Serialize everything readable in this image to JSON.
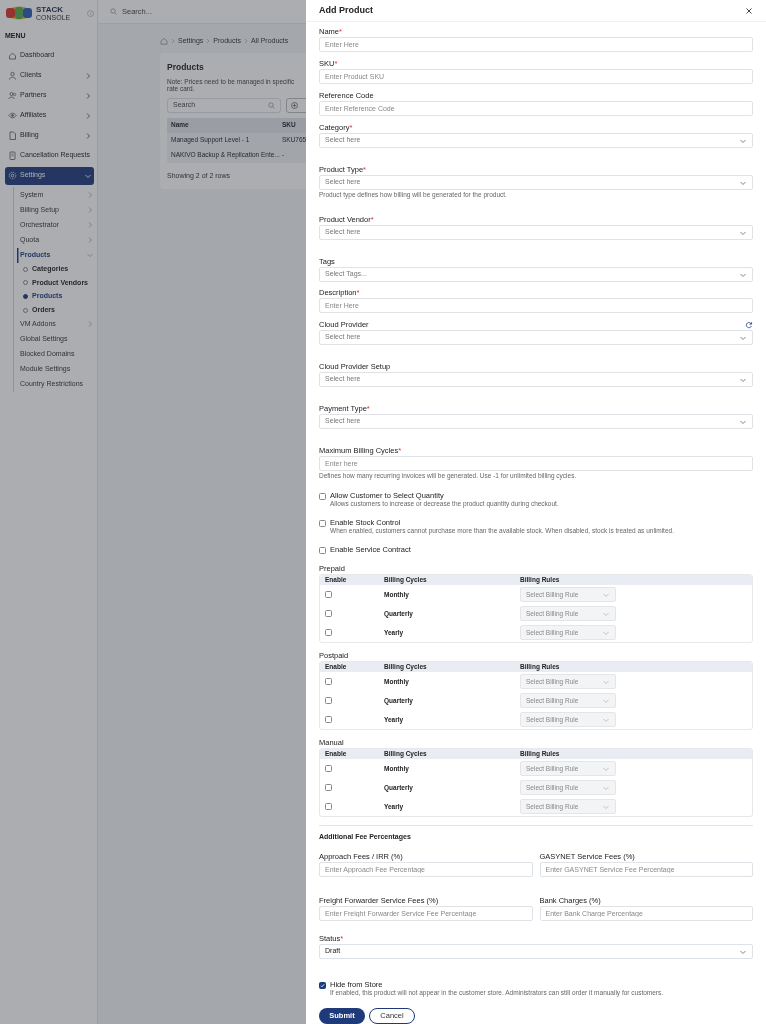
{
  "app": {
    "logo": {
      "name": "STACK",
      "sub": "CONSOLE"
    },
    "menu_label": "MENU",
    "sidebar": [
      {
        "label": "Dashboard",
        "selected": false
      },
      {
        "label": "Clients",
        "selected": false,
        "expanded": false
      },
      {
        "label": "Partners",
        "selected": false,
        "expanded": false
      },
      {
        "label": "Affiliates",
        "selected": false,
        "expanded": false
      },
      {
        "label": "Billing",
        "selected": false,
        "expanded": false
      },
      {
        "label": "Cancellation Requests",
        "selected": false
      },
      {
        "label": "Settings",
        "selected": true,
        "expanded": true,
        "children": [
          {
            "label": "System",
            "selected": false,
            "expanded": false
          },
          {
            "label": "Billing Setup",
            "selected": false,
            "expanded": false
          },
          {
            "label": "Orchestrator",
            "selected": false,
            "expanded": false
          },
          {
            "label": "Quota",
            "selected": false,
            "expanded": false
          },
          {
            "label": "Products",
            "selected": true,
            "expanded": true,
            "children": [
              {
                "label": "Categories",
                "selected": false
              },
              {
                "label": "Product Vendors",
                "selected": false
              },
              {
                "label": "Products",
                "selected": true
              },
              {
                "label": "Orders",
                "selected": false
              }
            ]
          },
          {
            "label": "VM Addons",
            "selected": false,
            "expanded": false
          },
          {
            "label": "Global Settings",
            "selected": false
          },
          {
            "label": "Blocked Domains",
            "selected": false
          },
          {
            "label": "Module Settings",
            "selected": false
          },
          {
            "label": "Country Restrictions",
            "selected": false
          }
        ]
      }
    ],
    "search": {
      "placeholder": "Search..."
    },
    "breadcrumb": [
      "Settings",
      "Products",
      "All Products"
    ],
    "products_card": {
      "title": "Products",
      "note": "Note: Prices need to be managed in specific rate card.",
      "search": {
        "placeholder": "Search"
      },
      "columns": [
        "Name",
        "SKU"
      ],
      "rows": [
        [
          "Managed Support Level - 1",
          "SKU765"
        ],
        [
          "NAKIVO Backup & Replication Ente...",
          "-"
        ]
      ],
      "footer": "Showing 2 of 2 rows"
    }
  },
  "drawer": {
    "title": "Add Product",
    "fields": [
      {
        "label": "Name",
        "mark": "*",
        "kind": "text",
        "placeholder": "Enter Here"
      },
      {
        "label": "SKU",
        "mark": "*",
        "kind": "text",
        "placeholder": "Enter Product SKU"
      },
      {
        "label": "Reference Code",
        "kind": "text",
        "placeholder": "Enter Reference Code"
      },
      {
        "label": "Category",
        "mark": "*",
        "kind": "select",
        "placeholder": "Select here"
      },
      {
        "label": "Product Type",
        "mark": "*",
        "kind": "select",
        "placeholder": "Select here",
        "help": "Product type defines how billing will be generated for the product."
      },
      {
        "label": "Product Vendor",
        "mark": "*",
        "kind": "select",
        "placeholder": "Select here"
      },
      {
        "label": "Tags",
        "kind": "tags",
        "placeholder": "Select Tags..."
      },
      {
        "label": "Description",
        "mark": "*",
        "kind": "text",
        "placeholder": "Enter Here"
      },
      {
        "label": "Cloud Provider",
        "kind": "select",
        "placeholder": "Select here",
        "refreshable": true
      },
      {
        "label": "Cloud Provider Setup",
        "kind": "select",
        "placeholder": "Select here"
      },
      {
        "label": "Payment Type",
        "mark": "*",
        "kind": "select",
        "placeholder": "Select here"
      },
      {
        "label": "Maximum Billing Cycles",
        "mark": "*",
        "kind": "text",
        "placeholder": "Enter here",
        "help": "Defines how many recurring invoices will be generated. Use -1 for unlimited billing cycles."
      }
    ],
    "options": [
      {
        "label": "Allow Customer to Select Quantity",
        "description": "Allows customers to increase or decrease the product quantity during checkout.",
        "checked": false
      },
      {
        "label": "Enable Stock Control",
        "description": "When enabled, customers cannot purchase more than the available stock. When disabled, stock is treated as unlimited.",
        "checked": false
      },
      {
        "label": "Enable Service Contract",
        "checked": false
      }
    ],
    "billing": [
      {
        "title": "Prepaid",
        "columns": [
          "Enable",
          "Billing Cycles",
          "Billing Rules"
        ],
        "rows": [
          {
            "cycle": "Monthly",
            "checked": false,
            "placeholder": "Select Billing Rule",
            "disabled": true
          },
          {
            "cycle": "Quarterly",
            "checked": false,
            "placeholder": "Select Billing Rule",
            "disabled": true
          },
          {
            "cycle": "Yearly",
            "checked": false,
            "placeholder": "Select Billing Rule",
            "disabled": true
          }
        ]
      },
      {
        "title": "Postpaid",
        "columns": [
          "Enable",
          "Billing Cycles",
          "Billing Rules"
        ],
        "rows": [
          {
            "cycle": "Monthly",
            "checked": false,
            "placeholder": "Select Billing Rule",
            "disabled": true
          },
          {
            "cycle": "Quarterly",
            "checked": false,
            "placeholder": "Select Billing Rule",
            "disabled": true
          },
          {
            "cycle": "Yearly",
            "checked": false,
            "placeholder": "Select Billing Rule",
            "disabled": true
          }
        ]
      },
      {
        "title": "Manual",
        "columns": [
          "Enable",
          "Billing Cycles",
          "Billing Rules"
        ],
        "rows": [
          {
            "cycle": "Monthly",
            "checked": false,
            "placeholder": "Select Billing Rule",
            "disabled": true
          },
          {
            "cycle": "Quarterly",
            "checked": false,
            "placeholder": "Select Billing Rule",
            "disabled": true
          },
          {
            "cycle": "Yearly",
            "checked": false,
            "placeholder": "Select Billing Rule",
            "disabled": true
          }
        ]
      }
    ],
    "fees": {
      "title": "Additional Fee Percentages",
      "fields": [
        {
          "label": "Approach Fees / IRR (%)",
          "placeholder": "Enter Approach Fee Percentage"
        },
        {
          "label": "GASYNET Service Fees (%)",
          "placeholder": "Enter GASYNET Service Fee Percentage"
        },
        {
          "label": "Freight Forwarder Service Fees (%)",
          "placeholder": "Enter Freight Forwarder Service Fee Percentage"
        },
        {
          "label": "Bank Charges (%)",
          "placeholder": "Enter Bank Charge Percentage"
        }
      ]
    },
    "status": {
      "label": "Status",
      "mark": "*",
      "kind": "select",
      "value": "Draft"
    },
    "hide_store": {
      "label": "Hide from Store",
      "description": "If enabled, this product will not appear in the customer store. Administrators can still order it manually for customers.",
      "checked": true
    },
    "buttons": [
      {
        "label": "Submit",
        "kind": "primary"
      },
      {
        "label": "Cancel",
        "kind": "outline"
      }
    ]
  }
}
